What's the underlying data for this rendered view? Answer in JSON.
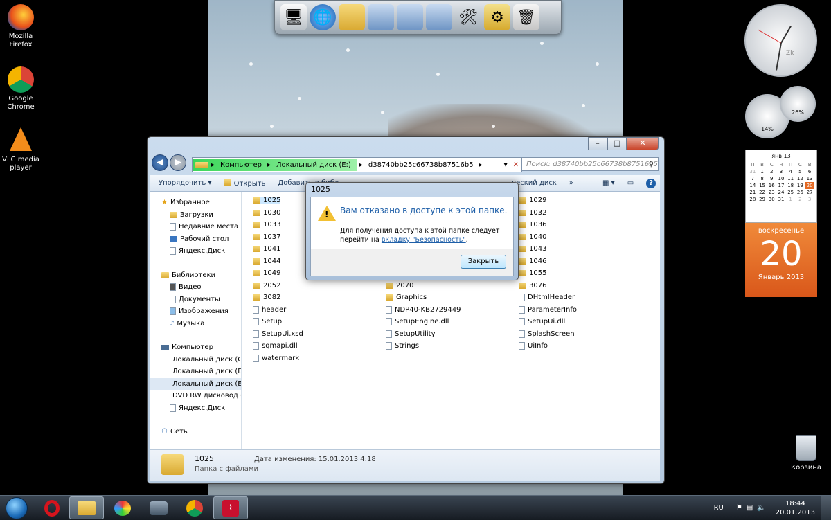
{
  "desktop": {
    "icons": [
      {
        "label_line1": "Mozilla",
        "label_line2": "Firefox"
      },
      {
        "label_line1": "Google",
        "label_line2": "Chrome"
      },
      {
        "label_line1": "VLC media",
        "label_line2": "player"
      }
    ],
    "recycle_bin": "Корзина"
  },
  "explorer": {
    "address": {
      "crumb1": "Компьютер",
      "crumb2": "Локальный диск (E:)",
      "crumb3": "d38740bb25c66738b87516b5"
    },
    "search_placeholder": "Поиск: d38740bb25c66738b87516b5",
    "toolbar": {
      "organize": "Упорядочить",
      "open": "Открыть",
      "add": "Добавить в библ",
      "disk_suffix": "ческий диск",
      "more": "»"
    },
    "nav": {
      "favorites": "Избранное",
      "downloads": "Загрузки",
      "recent": "Недавние места",
      "desktop": "Рабочий стол",
      "yadisk": "Яндекс.Диск",
      "libraries": "Библиотеки",
      "video": "Видео",
      "documents": "Документы",
      "images": "Изображения",
      "music": "Музыка",
      "computer": "Компьютер",
      "disk_c": "Локальный диск (C",
      "disk_d": "Локальный диск (D",
      "disk_e": "Локальный диск (E:",
      "dvd": "DVD RW дисковод (",
      "yadisk2": "Яндекс.Диск",
      "network": "Сеть"
    },
    "files_col1": [
      "1025",
      "1030",
      "1033",
      "1037",
      "1041",
      "1044",
      "1049",
      "2052",
      "3082",
      "header",
      "Setup",
      "SetupUi.xsd",
      "sqmapi.dll",
      "watermark"
    ],
    "files_col2": [
      "2070",
      "Graphics",
      "NDP40-KB2729449",
      "SetupEngine.dll",
      "SetupUtility",
      "Strings"
    ],
    "files_col3": [
      "1029",
      "1032",
      "1036",
      "1040",
      "1043",
      "1046",
      "1055",
      "3076",
      "DHtmlHeader",
      "ParameterInfo",
      "SetupUi.dll",
      "SplashScreen",
      "UiInfo"
    ],
    "details": {
      "name": "1025",
      "modified": "Дата изменения: 15.01.2013 4:18",
      "type": "Папка с файлами"
    }
  },
  "dialog": {
    "title": "1025",
    "heading": "Вам отказано в доступе к этой папке.",
    "body_line1": "Для получения доступа к этой папке следует",
    "body_prefix": "перейти на ",
    "body_link": "вкладку \"Безопасность\"",
    "body_suffix": ".",
    "close_button": "Закрыть"
  },
  "gadgets": {
    "clock_brand": "Zk",
    "cpu_percent": "14%",
    "mem_percent": "26%",
    "calendar": {
      "month_header": "янв 13",
      "weekdays": [
        "П",
        "В",
        "С",
        "Ч",
        "П",
        "С",
        "В"
      ],
      "rows": [
        [
          "31",
          "1",
          "2",
          "3",
          "4",
          "5",
          "6"
        ],
        [
          "7",
          "8",
          "9",
          "10",
          "11",
          "12",
          "13"
        ],
        [
          "14",
          "15",
          "16",
          "17",
          "18",
          "19",
          "20"
        ],
        [
          "21",
          "22",
          "23",
          "24",
          "25",
          "26",
          "27"
        ],
        [
          "28",
          "29",
          "30",
          "31",
          "1",
          "2",
          "3"
        ]
      ],
      "weekday_name": "воскресенье",
      "day": "20",
      "month_year": "Январь 2013"
    }
  },
  "taskbar": {
    "lang": "RU",
    "time": "18:44",
    "date": "20.01.2013"
  },
  "colors": {
    "accent": "#1e5fa8",
    "warning": "#f2c033",
    "calendar_orange": "#e46a24"
  }
}
